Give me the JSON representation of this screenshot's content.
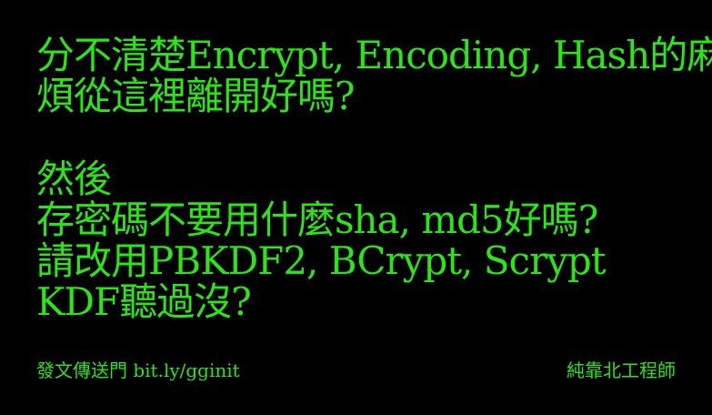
{
  "slide": {
    "lines": [
      "分不清楚Encrypt, Encoding, Hash的麻",
      "煩從這裡離開好嗎?",
      "然後",
      "存密碼不要用什麼sha, md5好嗎?",
      "請改用PBKDF2, BCrypt, Scrypt",
      "KDF聽過沒?"
    ]
  },
  "footer": {
    "left": "發文傳送門 bit.ly/gginit",
    "right": "純靠北工程師"
  },
  "colors": {
    "background": "#000000",
    "text": "#29e614"
  }
}
